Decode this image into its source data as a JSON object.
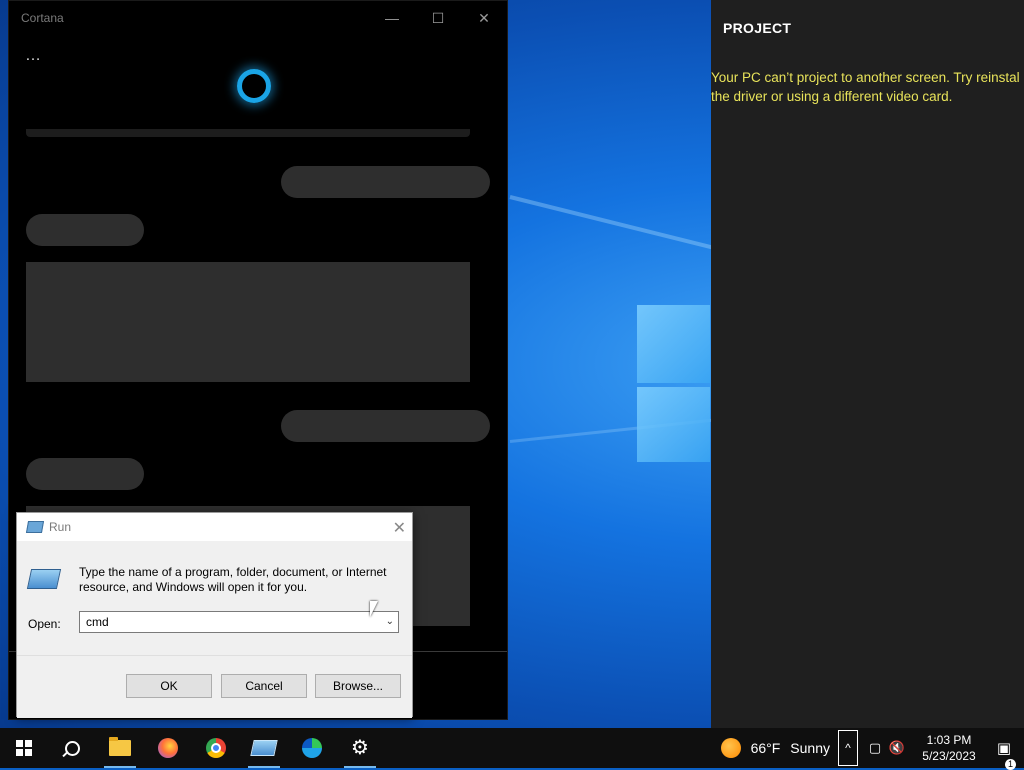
{
  "cortana": {
    "title": "Cortana",
    "minimize_glyph": "—",
    "maximize_glyph": "☐",
    "close_glyph": "✕",
    "menu_glyph": "…"
  },
  "project": {
    "title": "PROJECT",
    "message_line1": "Your PC can’t project to another screen. Try reinstal",
    "message_line2": "the driver or using a different video card."
  },
  "run": {
    "title": "Run",
    "close_glyph": "✕",
    "description": "Type the name of a program, folder, document, or Internet resource, and Windows will open it for you.",
    "open_label": "Open:",
    "input_value": "cmd",
    "ok": "OK",
    "cancel": "Cancel",
    "browse": "Browse..."
  },
  "taskbar": {
    "weather_temp": "66°F",
    "weather_cond": "Sunny",
    "time": "1:03 PM",
    "date": "5/23/2023",
    "notification_count": "1",
    "gear_glyph": "⚙",
    "chevron_glyph": "^"
  },
  "colors": {
    "accent": "#76b9ed",
    "project_message": "#e8e35a",
    "cortana_ring": "#1aa4e6"
  }
}
